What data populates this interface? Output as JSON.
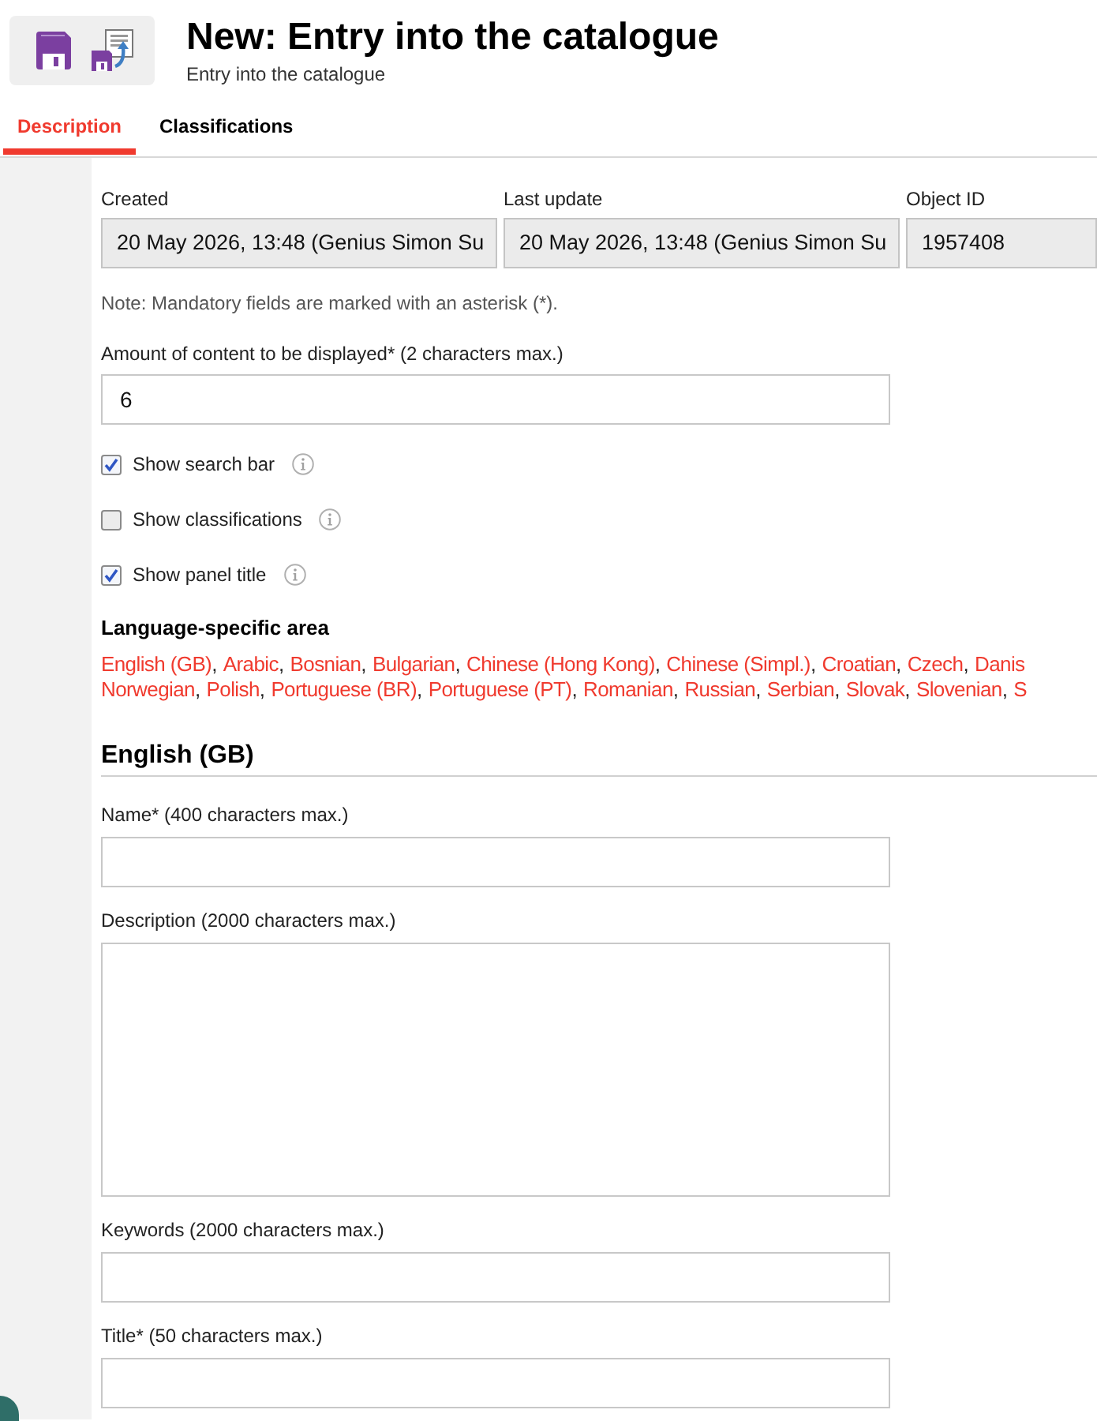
{
  "header": {
    "title": "New: Entry into the catalogue",
    "subtitle": "Entry into the catalogue"
  },
  "tabs": [
    {
      "label": "Description",
      "selected": true
    },
    {
      "label": "Classifications",
      "selected": false
    }
  ],
  "meta_fields": [
    {
      "label": "Created",
      "value": "20 May 2026, 13:48 (Genius Simon Su"
    },
    {
      "label": "Last update",
      "value": "20 May 2026, 13:48 (Genius Simon Su"
    },
    {
      "label": "Object ID",
      "value": "1957408"
    }
  ],
  "note": "Note: Mandatory fields are marked with an asterisk (*).",
  "amount_field": {
    "label": "Amount of content to be displayed* (2 characters max.)",
    "value": "6"
  },
  "options": [
    {
      "label": "Show search bar",
      "checked": true
    },
    {
      "label": "Show classifications",
      "checked": false
    },
    {
      "label": "Show panel title",
      "checked": true
    }
  ],
  "language_area": {
    "heading": "Language-specific area",
    "separator": ",",
    "lines": [
      {
        "links": [
          "English (GB)",
          "Arabic",
          "Bosnian",
          "Bulgarian",
          "Chinese (Hong Kong)",
          "Chinese (Simpl.)",
          "Croatian",
          "Czech",
          "Danis"
        ]
      },
      {
        "links": [
          "Norwegian",
          "Polish",
          "Portuguese (BR)",
          "Portuguese (PT)",
          "Romanian",
          "Russian",
          "Serbian",
          "Slovak",
          "Slovenian",
          "S"
        ]
      }
    ]
  },
  "section": {
    "heading": "English (GB)",
    "fields": [
      {
        "label": "Name* (400 characters max.)",
        "kind": "input"
      },
      {
        "label": "Description (2000 characters max.)",
        "kind": "textarea"
      },
      {
        "label": "Keywords (2000 characters max.)",
        "kind": "input"
      },
      {
        "label": "Title* (50 characters max.)",
        "kind": "input"
      }
    ]
  }
}
